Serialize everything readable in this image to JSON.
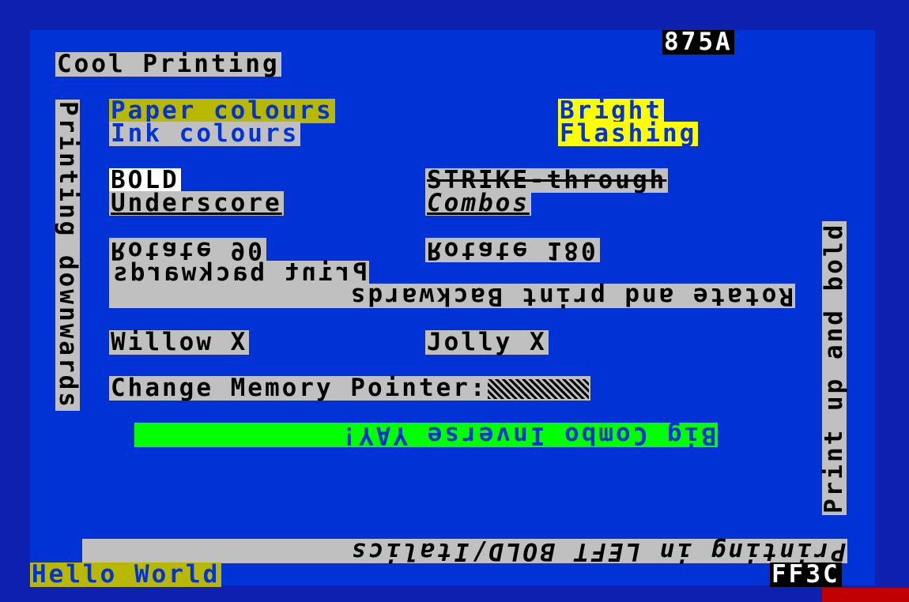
{
  "header": {
    "code": "875A",
    "title": "Cool Printing"
  },
  "colours": {
    "paper": "Paper colours",
    "ink": "Ink colours",
    "bright": "Bright",
    "flashing": "Flashing"
  },
  "styles": {
    "bold": "BOLD",
    "strike": "STRIKE-through",
    "underscore": "Underscore",
    "combos": "Combos"
  },
  "rotations": {
    "rotate90": "Rotate 90",
    "rotate180": "Rotate 180",
    "backwards": "Print backwards",
    "rotate_backwards": "Rotate and print Backwards"
  },
  "fonts": {
    "willow": "Willow X",
    "alt": "Jolly X"
  },
  "memory": {
    "label": "Change Memory Pointer:"
  },
  "big_combo": "Big Combo Inverse YAY!",
  "side_left": "Printing downwards",
  "side_right": "Print up and bold",
  "bottom_strip": "Printing in LEFT BOLD/Italics",
  "footer": {
    "hello": "Hello World",
    "code": "FF3C"
  },
  "colors": {
    "border": "#0d20b0",
    "paper": "#0032d6",
    "grey": "#c0c0c0",
    "yellow": "#c8c800",
    "bright_yellow": "#ffff00",
    "green": "#00ff00"
  }
}
